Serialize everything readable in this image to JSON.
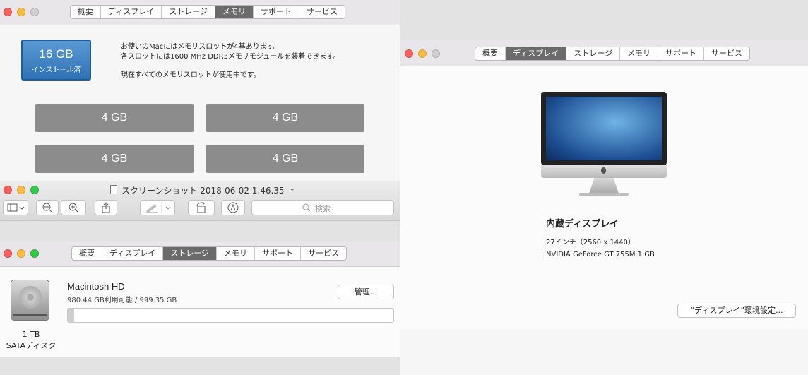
{
  "memory_window": {
    "tabs": [
      "概要",
      "ディスプレイ",
      "ストレージ",
      "メモリ",
      "サポート",
      "サービス"
    ],
    "active_tab": "メモリ",
    "installed_size": "16 GB",
    "installed_label": "インストール済",
    "info_line1": "お使いのMacにはメモリスロットが4基あります。",
    "info_line2": "各スロットには1600 MHz DDR3メモリモジュールを装着できます。",
    "info_line3": "現在すべてのメモリスロットが使用中です。",
    "slots": [
      "4 GB",
      "4 GB",
      "4 GB",
      "4 GB"
    ]
  },
  "display_window": {
    "tabs": [
      "概要",
      "ディスプレイ",
      "ストレージ",
      "メモリ",
      "サポート",
      "サービス"
    ],
    "active_tab": "ディスプレイ",
    "display_name": "内蔵ディスプレイ",
    "resolution": "27インチ（2560 x 1440）",
    "gpu": "NVIDIA GeForce GT 755M 1 GB",
    "prefs_button": "“ディスプレイ”環境設定..."
  },
  "preview_window": {
    "title": "スクリーンショット 2018-06-02 1.46.35",
    "search_placeholder": "検索"
  },
  "storage_window": {
    "tabs": [
      "概要",
      "ディスプレイ",
      "ストレージ",
      "メモリ",
      "サポート",
      "サービス"
    ],
    "active_tab": "ストレージ",
    "disk_name": "Macintosh HD",
    "disk_usage": "980.44 GB利用可能 / 999.35 GB",
    "manage_button": "管理...",
    "disk_size": "1 TB",
    "disk_type": "SATAディスク",
    "used_fraction": 0.019
  },
  "colors": {
    "close": "#fc605c",
    "minimize": "#fdbc40",
    "zoom": "#34c84a",
    "inactive_light": "#d0d0d0",
    "accent_blue": "#3a7fc4"
  }
}
